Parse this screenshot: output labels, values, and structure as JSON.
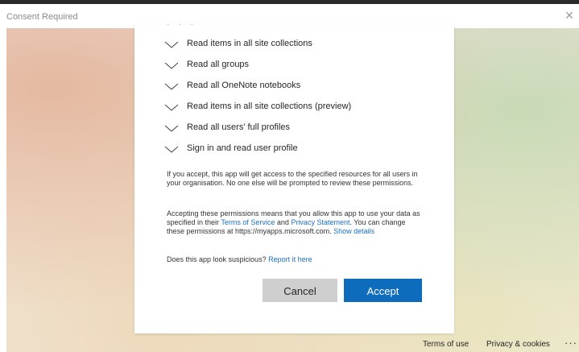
{
  "window": {
    "title": "Consent Required",
    "close_glyph": "✕"
  },
  "permissions": {
    "items": [
      {
        "label": "Read items in all site collections"
      },
      {
        "label": "Read all groups"
      },
      {
        "label": "Read all OneNote notebooks"
      },
      {
        "label": "Read items in all site collections (preview)"
      },
      {
        "label": "Read all users' full profiles"
      },
      {
        "label": "Sign in and read user profile"
      }
    ]
  },
  "notice": {
    "org_access": "If you accept, this app will get access to the specified resources for all users in your organisation. No one else will be prompted to review these permissions.",
    "data_use_prefix": "Accepting these permissions means that you allow this app to use your data as specified in their ",
    "terms_of_service_link": "Terms of Service",
    "and": " and ",
    "privacy_statement_link": "Privacy Statement",
    "change_permissions": ". You can change these permissions at https://myapps.microsoft.com. ",
    "show_details_link": "Show details",
    "suspicious_question": "Does this app look suspicious? ",
    "report_link": "Report it here"
  },
  "buttons": {
    "cancel": "Cancel",
    "accept": "Accept"
  },
  "footer": {
    "terms": "Terms of use",
    "privacy": "Privacy & cookies",
    "more": "···"
  },
  "colors": {
    "accent": "#0f6cbd",
    "link": "#1a6fc7",
    "cancel_bg": "#cfcfcf"
  },
  "icons": {
    "expand": "chevron-down-icon",
    "close": "close-icon",
    "more": "more-options-icon"
  }
}
